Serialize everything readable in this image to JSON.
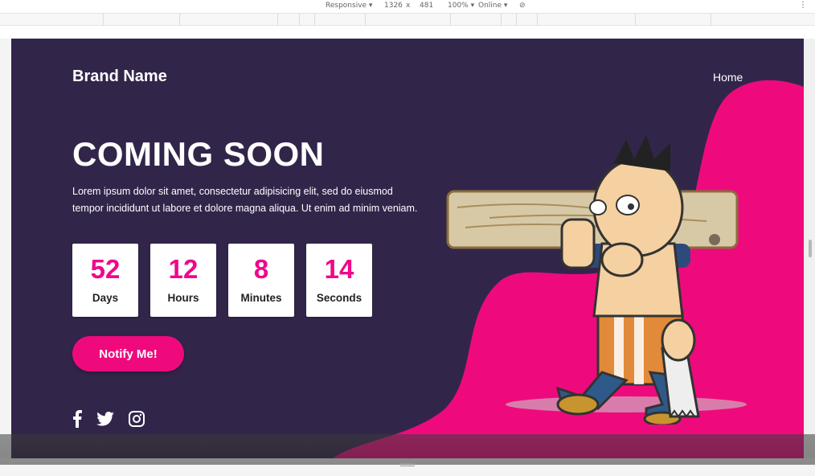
{
  "devtools": {
    "device": "Responsive",
    "width": "1326",
    "separator": "x",
    "height": "481",
    "zoom": "100%",
    "network": "Online"
  },
  "site": {
    "brand": "Brand Name",
    "nav": {
      "home": "Home"
    },
    "title": "COMING SOON",
    "description": "Lorem ipsum dolor sit amet, consectetur adipisicing elit, sed do eiusmod tempor incididunt ut labore et dolore magna aliqua. Ut enim ad minim veniam.",
    "countdown": [
      {
        "value": "52",
        "label": "Days"
      },
      {
        "value": "12",
        "label": "Hours"
      },
      {
        "value": "8",
        "label": "Minutes"
      },
      {
        "value": "14",
        "label": "Seconds"
      }
    ],
    "cta": "Notify Me!",
    "socials": [
      "facebook-icon",
      "twitter-icon",
      "instagram-icon"
    ]
  },
  "colors": {
    "background": "#32254a",
    "accent": "#ee0a7d",
    "number": "#f0078a"
  }
}
